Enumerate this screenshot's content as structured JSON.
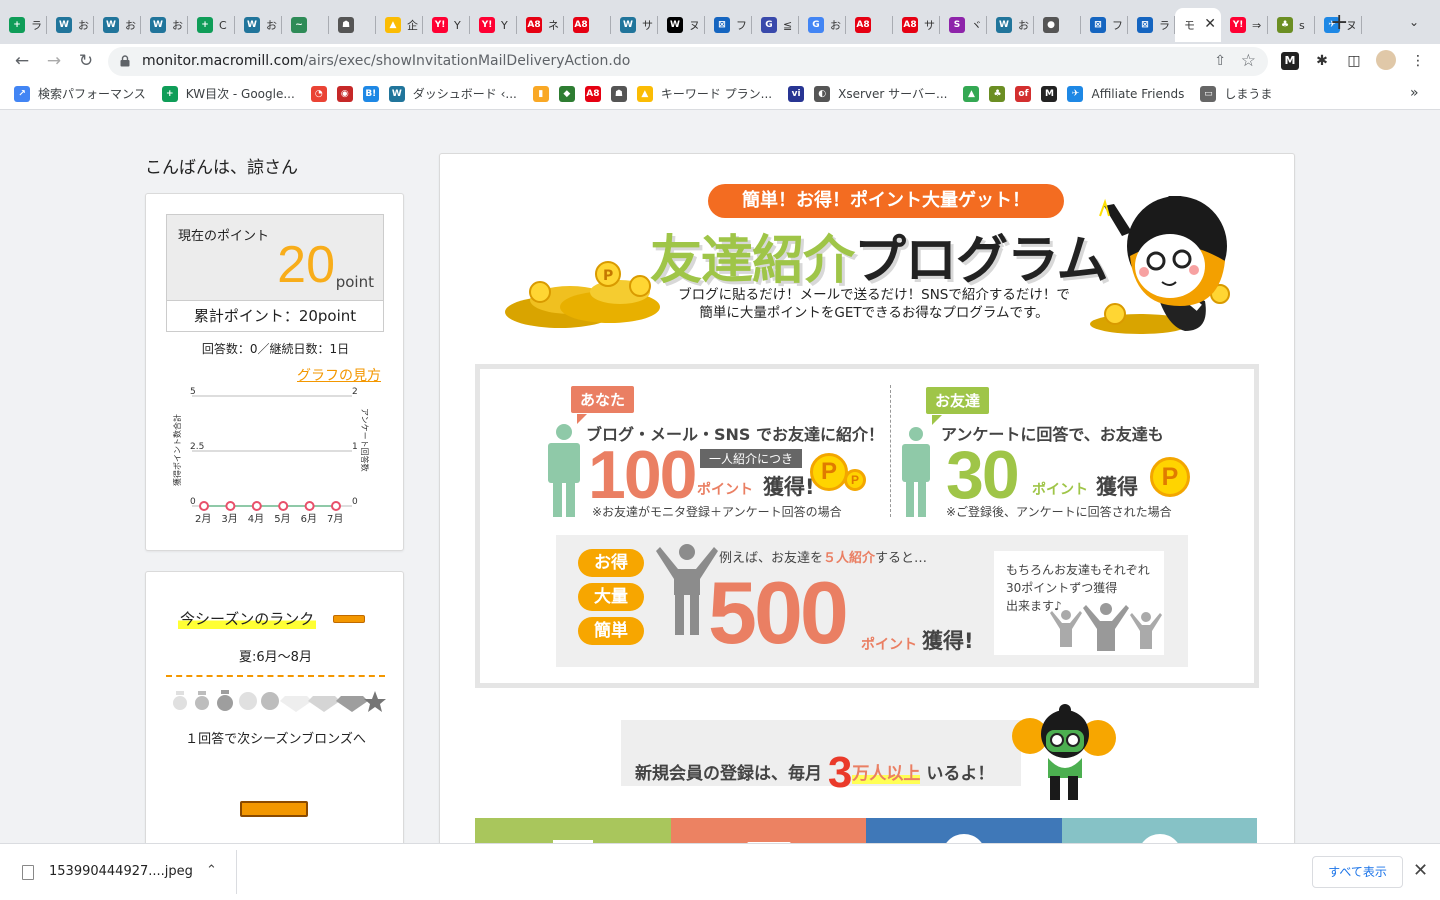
{
  "browser": {
    "tabs": [
      {
        "text": "ラ",
        "color": "#0f9d58",
        "glyph": "+"
      },
      {
        "text": "お",
        "color": "#21759b",
        "glyph": "W"
      },
      {
        "text": "お",
        "color": "#21759b",
        "glyph": "W"
      },
      {
        "text": "お",
        "color": "#21759b",
        "glyph": "W"
      },
      {
        "text": "C",
        "color": "#0f9d58",
        "glyph": "+"
      },
      {
        "text": "お",
        "color": "#21759b",
        "glyph": "W"
      },
      {
        "text": "",
        "color": "#2e8b57",
        "glyph": "~"
      },
      {
        "text": "",
        "color": "#555555",
        "glyph": "☗"
      },
      {
        "text": "企",
        "color": "#fbbc04",
        "glyph": "▲"
      },
      {
        "text": "Y",
        "color": "#ff0033",
        "glyph": "Y!"
      },
      {
        "text": "Y",
        "color": "#ff0033",
        "glyph": "Y!"
      },
      {
        "text": "ネ",
        "color": "#e60012",
        "glyph": "A8"
      },
      {
        "text": "",
        "color": "#e60012",
        "glyph": "A8"
      },
      {
        "text": "サ",
        "color": "#21759b",
        "glyph": "W"
      },
      {
        "text": "ヌ",
        "color": "#000000",
        "glyph": "W"
      },
      {
        "text": "フ",
        "color": "#1565c0",
        "glyph": "⊠"
      },
      {
        "text": "≦",
        "color": "#3949ab",
        "glyph": "G"
      },
      {
        "text": "お",
        "color": "#4285f4",
        "glyph": "G"
      },
      {
        "text": "",
        "color": "#e60012",
        "glyph": "A8"
      },
      {
        "text": "サ",
        "color": "#e60012",
        "glyph": "A8"
      },
      {
        "text": "ヾ",
        "color": "#8e24aa",
        "glyph": "S"
      },
      {
        "text": "お",
        "color": "#21759b",
        "glyph": "W"
      },
      {
        "text": "",
        "color": "#555555",
        "glyph": "●"
      },
      {
        "text": "フ",
        "color": "#1565c0",
        "glyph": "⊠"
      },
      {
        "text": "ラ",
        "color": "#1565c0",
        "glyph": "⊠"
      },
      {
        "text": "モ",
        "color": "#888888",
        "glyph": "",
        "active": true
      },
      {
        "text": "⇒",
        "color": "#ff0033",
        "glyph": "Y!"
      },
      {
        "text": "s",
        "color": "#6b8e23",
        "glyph": "♣"
      },
      {
        "text": "ヌ",
        "color": "#1e88e5",
        "glyph": "✈"
      }
    ],
    "new_tab": "+",
    "url_host": "monitor.macromill.com",
    "url_path": "/airs/exec/showInvitationMailDeliveryAction.do",
    "bookmarks": [
      {
        "label": "検索パフォーマンス",
        "color": "#4285f4",
        "glyph": "↗"
      },
      {
        "label": "KW目次 - Google...",
        "color": "#0f9d58",
        "glyph": "+"
      },
      {
        "label": "",
        "color": "#ea4335",
        "glyph": "◔"
      },
      {
        "label": "",
        "color": "#c62828",
        "glyph": "◉"
      },
      {
        "label": "",
        "color": "#1e88e5",
        "glyph": "B!"
      },
      {
        "label": "ダッシュボード ‹...",
        "color": "#21759b",
        "glyph": "W"
      },
      {
        "label": "",
        "color": "#f9a825",
        "glyph": "▮"
      },
      {
        "label": "",
        "color": "#2e7d32",
        "glyph": "◆"
      },
      {
        "label": "",
        "color": "#e60012",
        "glyph": "A8"
      },
      {
        "label": "",
        "color": "#555555",
        "glyph": "☗"
      },
      {
        "label": "キーワード プラン...",
        "color": "#fbbc04",
        "glyph": "▲"
      },
      {
        "label": "",
        "color": "#283593",
        "glyph": "vi"
      },
      {
        "label": "Xserver サーバー...",
        "color": "#555555",
        "glyph": "◐"
      },
      {
        "label": "",
        "color": "#34a853",
        "glyph": "▲"
      },
      {
        "label": "",
        "color": "#6b8e23",
        "glyph": "♣"
      },
      {
        "label": "",
        "color": "#d32f2f",
        "glyph": "of"
      },
      {
        "label": "",
        "color": "#222222",
        "glyph": "M"
      },
      {
        "label": "Affiliate Friends",
        "color": "#1e88e5",
        "glyph": "✈"
      },
      {
        "label": "しまうま",
        "color": "#666666",
        "glyph": "▭"
      }
    ]
  },
  "greeting": "こんばんは、諒さん",
  "points": {
    "label": "現在のポイント",
    "value": "20",
    "unit": "point",
    "total": "累計ポイント：20point",
    "answers": "回答数：0／継続日数：1日",
    "graph_link": "グラフの見方"
  },
  "chart_data": {
    "type": "line",
    "categories": [
      "2月",
      "3月",
      "4月",
      "5月",
      "6月",
      "7月"
    ],
    "series": [
      {
        "values": [
          0,
          0,
          0,
          0,
          0,
          0
        ]
      }
    ],
    "ylabel": "獲得ポイント数合計",
    "y2label": "アンケート回答数",
    "ylim": [
      0,
      5
    ],
    "y2lim": [
      0,
      2
    ],
    "yticks": [
      "0",
      "2.5",
      "5"
    ],
    "y2ticks": [
      "0",
      "1",
      "2"
    ],
    "grid": true,
    "line_color": "#8fc9a8",
    "marker_color": "#e8506a"
  },
  "rank": {
    "title": "今シーズンのランク",
    "season": "夏:6月〜8月",
    "next": "１回答で次シーズンブロンズへ"
  },
  "promo": {
    "banner": "簡単！お得！ポイント大量ゲット！",
    "title_green": "友達紹介",
    "title_black": "プログラム",
    "desc_line1": "ブログに貼るだけ！メールで送るだけ！SNSで紹介するだけ！で",
    "desc_line2": "簡単に大量ポイントをGETできるお得なプログラムです。"
  },
  "benefits": {
    "you": {
      "tag": "あなた",
      "headline": "ブログ・メール・SNS でお友達に紹介！",
      "per": "一人紹介につき",
      "number": "100",
      "pt": "ポイント",
      "get": "獲得!",
      "note": "※お友達がモニタ登録＋アンケート回答の場合"
    },
    "friend": {
      "tag": "お友達",
      "headline": "アンケートに回答で、お友達も",
      "number": "30",
      "pt": "ポイント",
      "get": "獲得",
      "note": "※ご登録後、アンケートに回答された場合"
    },
    "coin_glyph": "P"
  },
  "example": {
    "pills": [
      "お得",
      "大量",
      "簡単"
    ],
    "text_pre": "例えば、お友達を",
    "text_hl": "５人紹介",
    "text_post": "すると…",
    "number": "500",
    "pt": "ポイント",
    "get": "獲得!",
    "note_line1": "もちろんお友達もそれぞれ",
    "note_line2": "30ポイントずつ獲得",
    "note_line3": "出来ます♪"
  },
  "members": {
    "pre": "新規会員の登録は、毎月",
    "num": "3",
    "unit": "万人以上",
    "post": "いるよ！"
  },
  "share_tiles": [
    {
      "color": "#a9c65c"
    },
    {
      "color": "#ec8262"
    },
    {
      "color": "#3f78b8"
    },
    {
      "color": "#86c2c6"
    }
  ],
  "download": {
    "filename": "153990444927....jpeg",
    "show_all": "すべて表示"
  }
}
